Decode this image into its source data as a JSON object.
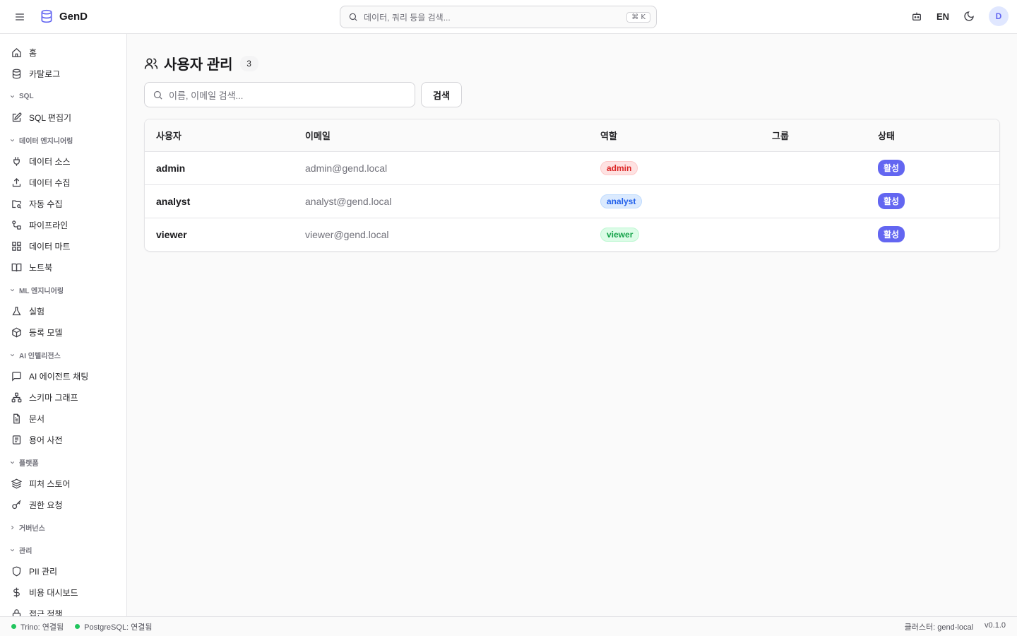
{
  "app": {
    "name": "GenD",
    "search_placeholder": "데이터, 쿼리 등을 검색...",
    "search_shortcut": "⌘ K",
    "language": "EN",
    "avatar_initial": "D"
  },
  "sidebar": {
    "top_items": [
      {
        "label": "홈",
        "icon": "home-icon"
      },
      {
        "label": "카탈로그",
        "icon": "database-icon"
      }
    ],
    "sections": [
      {
        "title": "SQL",
        "expanded": true,
        "items": [
          {
            "label": "SQL 편집기",
            "icon": "edit-icon"
          }
        ]
      },
      {
        "title": "데이터 엔지니어링",
        "expanded": true,
        "items": [
          {
            "label": "데이터 소스",
            "icon": "plug-icon"
          },
          {
            "label": "데이터 수집",
            "icon": "upload-icon"
          },
          {
            "label": "자동 수집",
            "icon": "folder-search-icon"
          },
          {
            "label": "파이프라인",
            "icon": "workflow-icon"
          },
          {
            "label": "데이터 마트",
            "icon": "grid-icon"
          },
          {
            "label": "노트북",
            "icon": "book-icon"
          }
        ]
      },
      {
        "title": "ML 엔지니어링",
        "expanded": true,
        "items": [
          {
            "label": "실험",
            "icon": "flask-icon"
          },
          {
            "label": "등록 모델",
            "icon": "package-icon"
          }
        ]
      },
      {
        "title": "AI 인텔리전스",
        "expanded": true,
        "items": [
          {
            "label": "AI 에이전트 채팅",
            "icon": "chat-icon"
          },
          {
            "label": "스키마 그래프",
            "icon": "network-icon"
          },
          {
            "label": "문서",
            "icon": "document-icon"
          },
          {
            "label": "용어 사전",
            "icon": "glossary-icon"
          }
        ]
      },
      {
        "title": "플랫폼",
        "expanded": true,
        "items": [
          {
            "label": "피처 스토어",
            "icon": "layers-icon"
          },
          {
            "label": "권한 요청",
            "icon": "key-icon"
          }
        ]
      },
      {
        "title": "거버넌스",
        "expanded": false,
        "items": []
      },
      {
        "title": "관리",
        "expanded": true,
        "items": [
          {
            "label": "PII 관리",
            "icon": "shield-icon"
          },
          {
            "label": "비용 대시보드",
            "icon": "dollar-icon"
          },
          {
            "label": "접근 정책",
            "icon": "lock-icon"
          }
        ]
      }
    ]
  },
  "page": {
    "title": "사용자 관리",
    "count": "3",
    "search_placeholder": "이름, 이메일 검색...",
    "search_button": "검색"
  },
  "table": {
    "headers": [
      "사용자",
      "이메일",
      "역할",
      "그룹",
      "상태"
    ],
    "rows": [
      {
        "user": "admin",
        "email": "admin@gend.local",
        "role": "admin",
        "role_color": "#dc2626",
        "role_bg": "#fee2e2",
        "role_border": "#fecaca",
        "group": "",
        "status": "활성"
      },
      {
        "user": "analyst",
        "email": "analyst@gend.local",
        "role": "analyst",
        "role_color": "#2563eb",
        "role_bg": "#dbeafe",
        "role_border": "#bfdbfe",
        "group": "",
        "status": "활성"
      },
      {
        "user": "viewer",
        "email": "viewer@gend.local",
        "role": "viewer",
        "role_color": "#16a34a",
        "role_bg": "#dcfce7",
        "role_border": "#bbf7d0",
        "group": "",
        "status": "활성"
      }
    ]
  },
  "footer": {
    "trino": "Trino: 연결됨",
    "postgres": "PostgreSQL: 연결됨",
    "status_color": "#22c55e",
    "cluster": "클러스터: gend-local",
    "version": "v0.1.0"
  }
}
